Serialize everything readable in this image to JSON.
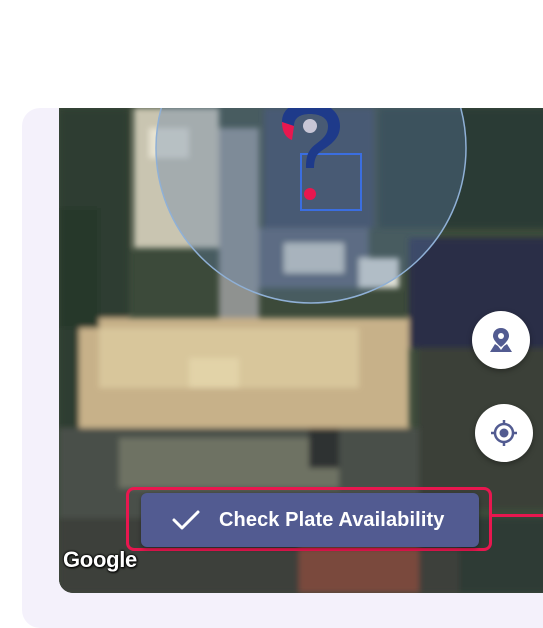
{
  "map": {
    "check_button_label": "Check Plate Availability",
    "attribution": "Google",
    "icons": {
      "marker": "question-marker-icon",
      "location_button": "map-pin-icon",
      "locate_button": "crosshair-icon",
      "check": "check-icon"
    }
  },
  "colors": {
    "button": "#525b91",
    "highlight": "#e8174f",
    "marker_navy": "#1e3a8a",
    "marker_red": "#e8174f",
    "card": "#f4f1fb"
  }
}
